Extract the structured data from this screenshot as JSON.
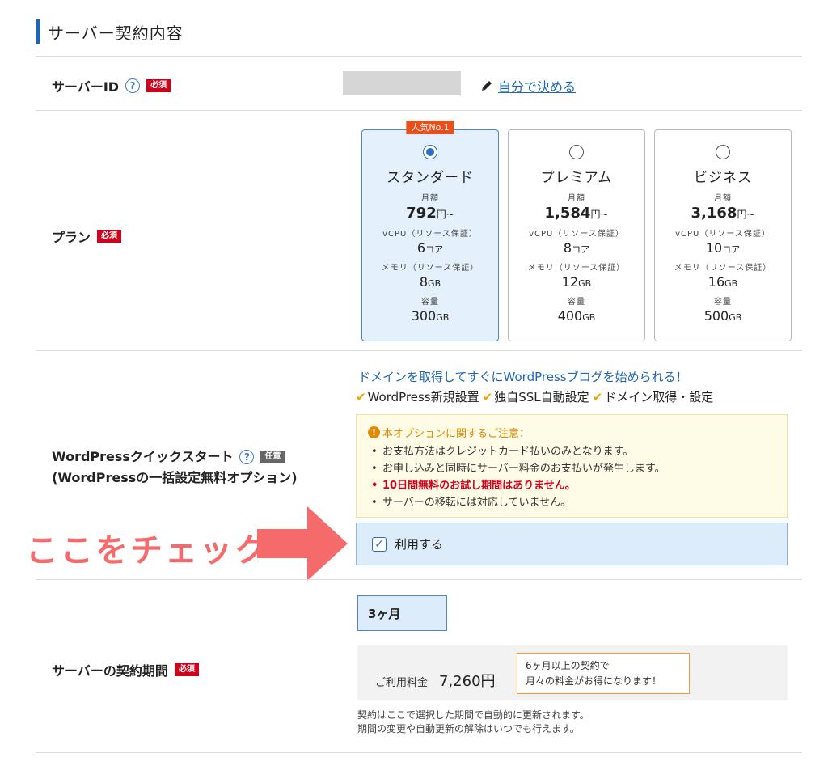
{
  "section": {
    "title": "サーバー契約内容"
  },
  "server_id": {
    "label": "サーバーID",
    "help": "?",
    "required_badge": "必須",
    "self_link": "自分で決める",
    "value": ""
  },
  "plan": {
    "label": "プラン",
    "required_badge": "必須",
    "popular_badge": "人気No.1",
    "options": [
      {
        "name": "スタンダード",
        "price_label": "月額",
        "price": "792",
        "price_unit": "円~",
        "cpu_label": "vCPU（リソース保証）",
        "cpu": "6",
        "cpu_unit": "コア",
        "mem_label": "メモリ（リソース保証）",
        "mem": "8",
        "mem_unit": "GB",
        "disk_label": "容量",
        "disk": "300",
        "disk_unit": "GB",
        "selected": true
      },
      {
        "name": "プレミアム",
        "price_label": "月額",
        "price": "1,584",
        "price_unit": "円~",
        "cpu_label": "vCPU（リソース保証）",
        "cpu": "8",
        "cpu_unit": "コア",
        "mem_label": "メモリ（リソース保証）",
        "mem": "12",
        "mem_unit": "GB",
        "disk_label": "容量",
        "disk": "400",
        "disk_unit": "GB",
        "selected": false
      },
      {
        "name": "ビジネス",
        "price_label": "月額",
        "price": "3,168",
        "price_unit": "円~",
        "cpu_label": "vCPU（リソース保証）",
        "cpu": "10",
        "cpu_unit": "コア",
        "mem_label": "メモリ（リソース保証）",
        "mem": "16",
        "mem_unit": "GB",
        "disk_label": "容量",
        "disk": "500",
        "disk_unit": "GB",
        "selected": false
      }
    ]
  },
  "wordpress": {
    "label_line1": "WordPressクイックスタート",
    "label_line2": "(WordPressの一括設定無料オプション)",
    "help": "?",
    "optional_badge": "任意",
    "intro": "ドメインを取得してすぐにWordPressブログを始められる！",
    "features": [
      "WordPress新規設置",
      "独自SSL自動設定",
      "ドメイン取得・設定"
    ],
    "notice_title": "本オプションに関するご注意：",
    "notices": [
      "お支払方法はクレジットカード払いのみとなります。",
      "お申し込みと同時にサーバー料金のお支払いが発生します。",
      "10日間無料のお試し期間はありません。",
      "サーバーの移転には対応していません。"
    ],
    "use_label": "利用する",
    "use_checked": true
  },
  "callout": {
    "text": "ここをチェック",
    "color": "#f56b6b"
  },
  "period": {
    "label": "サーバーの契約期間",
    "required_badge": "必須",
    "selected": "3ヶ月",
    "fee_label": "ご利用料金",
    "fee_value": "7,260円",
    "promo_line1": "6ヶ月以上の契約で",
    "promo_line2": "月々の料金がお得になります！",
    "note_line1": "契約はここで選択した期間で自動的に更新されます。",
    "note_line2": "期間の変更や自動更新の解除はいつでも行えます。"
  },
  "colors": {
    "accent": "#1e67b7",
    "required": "#d0021b",
    "popular": "#e94e1b",
    "selected_bg": "#e4f0fb"
  }
}
